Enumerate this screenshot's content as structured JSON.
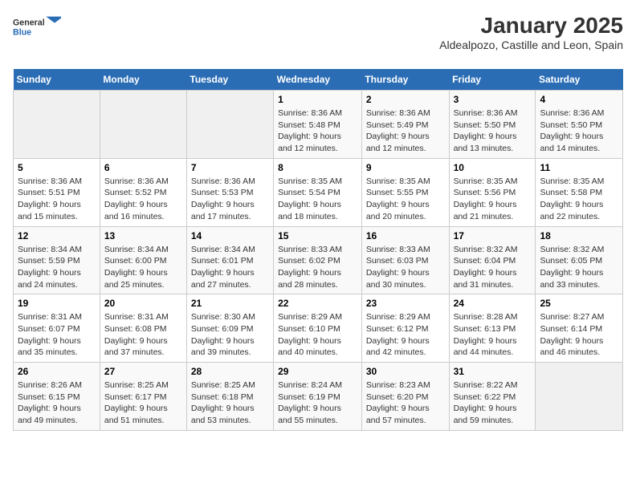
{
  "logo": {
    "general": "General",
    "blue": "Blue"
  },
  "title": "January 2025",
  "subtitle": "Aldealpozo, Castille and Leon, Spain",
  "headers": [
    "Sunday",
    "Monday",
    "Tuesday",
    "Wednesday",
    "Thursday",
    "Friday",
    "Saturday"
  ],
  "weeks": [
    [
      {
        "day": "",
        "sunrise": "",
        "sunset": "",
        "daylight": "",
        "empty": true
      },
      {
        "day": "",
        "sunrise": "",
        "sunset": "",
        "daylight": "",
        "empty": true
      },
      {
        "day": "",
        "sunrise": "",
        "sunset": "",
        "daylight": "",
        "empty": true
      },
      {
        "day": "1",
        "sunrise": "Sunrise: 8:36 AM",
        "sunset": "Sunset: 5:48 PM",
        "daylight": "Daylight: 9 hours and 12 minutes."
      },
      {
        "day": "2",
        "sunrise": "Sunrise: 8:36 AM",
        "sunset": "Sunset: 5:49 PM",
        "daylight": "Daylight: 9 hours and 12 minutes."
      },
      {
        "day": "3",
        "sunrise": "Sunrise: 8:36 AM",
        "sunset": "Sunset: 5:50 PM",
        "daylight": "Daylight: 9 hours and 13 minutes."
      },
      {
        "day": "4",
        "sunrise": "Sunrise: 8:36 AM",
        "sunset": "Sunset: 5:50 PM",
        "daylight": "Daylight: 9 hours and 14 minutes."
      }
    ],
    [
      {
        "day": "5",
        "sunrise": "Sunrise: 8:36 AM",
        "sunset": "Sunset: 5:51 PM",
        "daylight": "Daylight: 9 hours and 15 minutes."
      },
      {
        "day": "6",
        "sunrise": "Sunrise: 8:36 AM",
        "sunset": "Sunset: 5:52 PM",
        "daylight": "Daylight: 9 hours and 16 minutes."
      },
      {
        "day": "7",
        "sunrise": "Sunrise: 8:36 AM",
        "sunset": "Sunset: 5:53 PM",
        "daylight": "Daylight: 9 hours and 17 minutes."
      },
      {
        "day": "8",
        "sunrise": "Sunrise: 8:35 AM",
        "sunset": "Sunset: 5:54 PM",
        "daylight": "Daylight: 9 hours and 18 minutes."
      },
      {
        "day": "9",
        "sunrise": "Sunrise: 8:35 AM",
        "sunset": "Sunset: 5:55 PM",
        "daylight": "Daylight: 9 hours and 20 minutes."
      },
      {
        "day": "10",
        "sunrise": "Sunrise: 8:35 AM",
        "sunset": "Sunset: 5:56 PM",
        "daylight": "Daylight: 9 hours and 21 minutes."
      },
      {
        "day": "11",
        "sunrise": "Sunrise: 8:35 AM",
        "sunset": "Sunset: 5:58 PM",
        "daylight": "Daylight: 9 hours and 22 minutes."
      }
    ],
    [
      {
        "day": "12",
        "sunrise": "Sunrise: 8:34 AM",
        "sunset": "Sunset: 5:59 PM",
        "daylight": "Daylight: 9 hours and 24 minutes."
      },
      {
        "day": "13",
        "sunrise": "Sunrise: 8:34 AM",
        "sunset": "Sunset: 6:00 PM",
        "daylight": "Daylight: 9 hours and 25 minutes."
      },
      {
        "day": "14",
        "sunrise": "Sunrise: 8:34 AM",
        "sunset": "Sunset: 6:01 PM",
        "daylight": "Daylight: 9 hours and 27 minutes."
      },
      {
        "day": "15",
        "sunrise": "Sunrise: 8:33 AM",
        "sunset": "Sunset: 6:02 PM",
        "daylight": "Daylight: 9 hours and 28 minutes."
      },
      {
        "day": "16",
        "sunrise": "Sunrise: 8:33 AM",
        "sunset": "Sunset: 6:03 PM",
        "daylight": "Daylight: 9 hours and 30 minutes."
      },
      {
        "day": "17",
        "sunrise": "Sunrise: 8:32 AM",
        "sunset": "Sunset: 6:04 PM",
        "daylight": "Daylight: 9 hours and 31 minutes."
      },
      {
        "day": "18",
        "sunrise": "Sunrise: 8:32 AM",
        "sunset": "Sunset: 6:05 PM",
        "daylight": "Daylight: 9 hours and 33 minutes."
      }
    ],
    [
      {
        "day": "19",
        "sunrise": "Sunrise: 8:31 AM",
        "sunset": "Sunset: 6:07 PM",
        "daylight": "Daylight: 9 hours and 35 minutes."
      },
      {
        "day": "20",
        "sunrise": "Sunrise: 8:31 AM",
        "sunset": "Sunset: 6:08 PM",
        "daylight": "Daylight: 9 hours and 37 minutes."
      },
      {
        "day": "21",
        "sunrise": "Sunrise: 8:30 AM",
        "sunset": "Sunset: 6:09 PM",
        "daylight": "Daylight: 9 hours and 39 minutes."
      },
      {
        "day": "22",
        "sunrise": "Sunrise: 8:29 AM",
        "sunset": "Sunset: 6:10 PM",
        "daylight": "Daylight: 9 hours and 40 minutes."
      },
      {
        "day": "23",
        "sunrise": "Sunrise: 8:29 AM",
        "sunset": "Sunset: 6:12 PM",
        "daylight": "Daylight: 9 hours and 42 minutes."
      },
      {
        "day": "24",
        "sunrise": "Sunrise: 8:28 AM",
        "sunset": "Sunset: 6:13 PM",
        "daylight": "Daylight: 9 hours and 44 minutes."
      },
      {
        "day": "25",
        "sunrise": "Sunrise: 8:27 AM",
        "sunset": "Sunset: 6:14 PM",
        "daylight": "Daylight: 9 hours and 46 minutes."
      }
    ],
    [
      {
        "day": "26",
        "sunrise": "Sunrise: 8:26 AM",
        "sunset": "Sunset: 6:15 PM",
        "daylight": "Daylight: 9 hours and 49 minutes."
      },
      {
        "day": "27",
        "sunrise": "Sunrise: 8:25 AM",
        "sunset": "Sunset: 6:17 PM",
        "daylight": "Daylight: 9 hours and 51 minutes."
      },
      {
        "day": "28",
        "sunrise": "Sunrise: 8:25 AM",
        "sunset": "Sunset: 6:18 PM",
        "daylight": "Daylight: 9 hours and 53 minutes."
      },
      {
        "day": "29",
        "sunrise": "Sunrise: 8:24 AM",
        "sunset": "Sunset: 6:19 PM",
        "daylight": "Daylight: 9 hours and 55 minutes."
      },
      {
        "day": "30",
        "sunrise": "Sunrise: 8:23 AM",
        "sunset": "Sunset: 6:20 PM",
        "daylight": "Daylight: 9 hours and 57 minutes."
      },
      {
        "day": "31",
        "sunrise": "Sunrise: 8:22 AM",
        "sunset": "Sunset: 6:22 PM",
        "daylight": "Daylight: 9 hours and 59 minutes."
      },
      {
        "day": "",
        "sunrise": "",
        "sunset": "",
        "daylight": "",
        "empty": true
      }
    ]
  ]
}
